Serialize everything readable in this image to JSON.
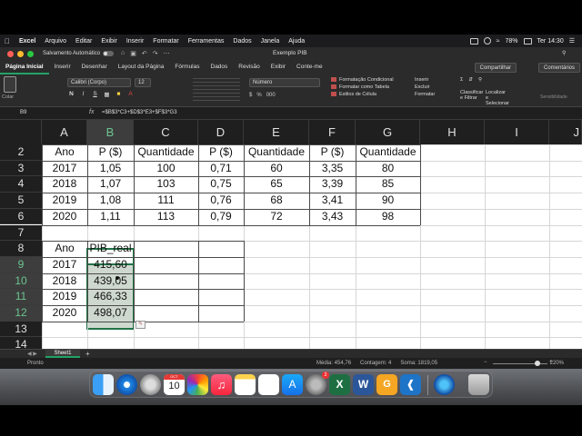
{
  "menubar": {
    "app": "Excel",
    "items": [
      "Arquivo",
      "Editar",
      "Exibir",
      "Inserir",
      "Formatar",
      "Ferramentas",
      "Dados",
      "Janela",
      "Ajuda"
    ],
    "battery": "78%",
    "clock": "Ter 14:30"
  },
  "window": {
    "autosave_label": "Salvamento Automático",
    "title": "Exemplo PIB"
  },
  "ribbon": {
    "tabs": [
      "Página Inicial",
      "Inserir",
      "Desenhar",
      "Layout da Página",
      "Fórmulas",
      "Dados",
      "Revisão",
      "Exibir",
      "Conte-me"
    ],
    "share": "Compartilhar",
    "comments": "Comentários",
    "paste": "Colar",
    "font": "Calibri (Corpo)",
    "font_size": "12",
    "number_format": "Número",
    "styles": [
      "Formatação Condicional",
      "Formatar como Tabela",
      "Estilos de Célula"
    ],
    "cells": [
      "Inserir",
      "Excluir",
      "Formatar"
    ],
    "edit": "Classificar e Filtrar",
    "find": "Localizar e Selecionar",
    "sensitivity": "Sensibilidade"
  },
  "formula_bar": {
    "name_box": "B9",
    "fx": "fx",
    "formula": "=$B$3*C3+$D$3*E3+$F$3*G3"
  },
  "columns": [
    "A",
    "B",
    "C",
    "D",
    "E",
    "F",
    "G",
    "H",
    "I",
    "J"
  ],
  "rows": [
    "2",
    "3",
    "4",
    "5",
    "6",
    "7",
    "8",
    "9",
    "10",
    "11",
    "12",
    "13",
    "14"
  ],
  "table1": {
    "headers": [
      "Ano",
      "P ($)",
      "Quantidade",
      "P ($)",
      "Quantidade",
      "P ($)",
      "Quantidade"
    ],
    "data": [
      [
        "2017",
        "1,05",
        "100",
        "0,71",
        "60",
        "3,35",
        "80"
      ],
      [
        "2018",
        "1,07",
        "103",
        "0,75",
        "65",
        "3,39",
        "85"
      ],
      [
        "2019",
        "1,08",
        "111",
        "0,76",
        "68",
        "3,41",
        "90"
      ],
      [
        "2020",
        "1,11",
        "113",
        "0,79",
        "72",
        "3,43",
        "98"
      ]
    ]
  },
  "table2": {
    "headers": [
      "Ano",
      "PIB_real"
    ],
    "data": [
      [
        "2017",
        "415,60"
      ],
      [
        "2018",
        "439,05"
      ],
      [
        "2019",
        "466,33"
      ],
      [
        "2020",
        "498,07"
      ]
    ]
  },
  "sheets": [
    "Sheet1"
  ],
  "status": {
    "ready": "Pronto",
    "average": "Média: 454,76",
    "count": "Contagem: 4",
    "sum": "Soma: 1819,05",
    "zoom": "220%"
  },
  "dock": {
    "apps": [
      "finder-icon",
      "safari-icon",
      "launchpad-icon",
      "calendar-icon",
      "photos-icon",
      "music-icon",
      "notes-icon",
      "reminders-icon",
      "app-store-icon",
      "system-preferences-icon",
      "excel-icon",
      "word-icon",
      "pdf-icon",
      "vscode-icon",
      "camtasia-icon",
      "trash-icon"
    ],
    "calendar_day": "10",
    "calendar_month": "OCT",
    "prefs_badge": "2"
  },
  "colors": {
    "excel_green": "#217346",
    "tab_accent": "#21a366"
  }
}
